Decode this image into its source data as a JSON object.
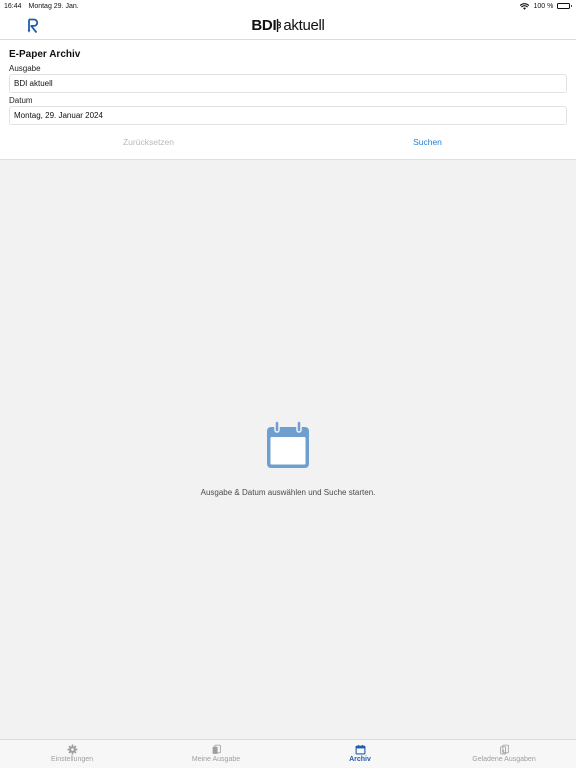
{
  "status": {
    "time": "16:44",
    "date": "Montag 29. Jan.",
    "battery": "100 %"
  },
  "nav": {
    "brand_bold": "BDI",
    "brand_light": "aktuell"
  },
  "form": {
    "title": "E-Paper Archiv",
    "ausgabe_label": "Ausgabe",
    "ausgabe_value": "BDI aktuell",
    "datum_label": "Datum",
    "datum_value": "Montag, 29. Januar 2024",
    "reset_label": "Zurücksetzen",
    "search_label": "Suchen"
  },
  "empty": {
    "message": "Ausgabe & Datum auswählen und Suche starten."
  },
  "tabs": [
    {
      "label": "Einstellungen",
      "icon": "gear-icon",
      "active": false
    },
    {
      "label": "Meine Ausgabe",
      "icon": "pages-icon",
      "active": false
    },
    {
      "label": "Archiv",
      "icon": "calendar-icon",
      "active": true
    },
    {
      "label": "Geladene Ausgaben",
      "icon": "download-icon",
      "active": false
    }
  ],
  "colors": {
    "accent": "#1f7fd6",
    "active_tab": "#1f5fa8",
    "icon_blue": "#6f9fcf"
  }
}
